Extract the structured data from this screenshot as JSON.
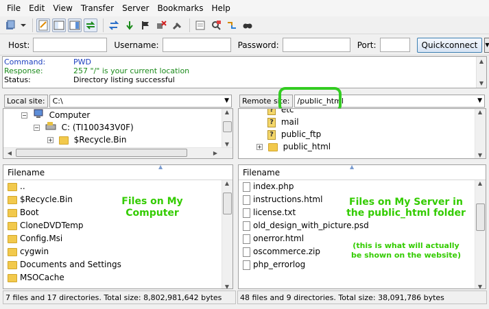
{
  "menu": [
    "File",
    "Edit",
    "View",
    "Transfer",
    "Server",
    "Bookmarks",
    "Help"
  ],
  "quickconnect": {
    "host_label": "Host:",
    "host_value": "",
    "username_label": "Username:",
    "username_value": "",
    "password_label": "Password:",
    "password_value": "",
    "port_label": "Port:",
    "port_value": "",
    "button_label": "Quickconnect"
  },
  "log": [
    {
      "type": "Command:",
      "text": "PWD"
    },
    {
      "type": "Response:",
      "text": "257 \"/\" is your current location"
    },
    {
      "type": "Status:",
      "text": "Directory listing successful"
    }
  ],
  "local": {
    "site_label": "Local site:",
    "path": "C:\\",
    "tree": [
      {
        "label": "Computer",
        "icon": "computer-icon"
      },
      {
        "label": "C: (TI100343V0F)",
        "icon": "drive-icon"
      },
      {
        "label": "$Recycle.Bin",
        "icon": "folder-icon"
      }
    ],
    "column": "Filename",
    "files": [
      "..",
      "$Recycle.Bin",
      "Boot",
      "CloneDVDTemp",
      "Config.Msi",
      "cygwin",
      "Documents and Settings",
      "MSOCache"
    ],
    "status": "7 files and 17 directories. Total size: 8,802,981,642 bytes",
    "annotation": "Files on My Computer"
  },
  "remote": {
    "site_label": "Remote site:",
    "path": "/public_html",
    "tree": [
      {
        "label": "etc",
        "icon": "unknown-folder-icon"
      },
      {
        "label": "mail",
        "icon": "unknown-folder-icon"
      },
      {
        "label": "public_ftp",
        "icon": "unknown-folder-icon"
      },
      {
        "label": "public_html",
        "icon": "folder-icon"
      }
    ],
    "column": "Filename",
    "files": [
      "index.php",
      "instructions.html",
      "license.txt",
      "old_design_with_picture.psd",
      "onerror.html",
      "oscommerce.zip",
      "php_errorlog"
    ],
    "status": "48 files and 9 directories. Total size: 38,091,786 bytes",
    "annotation_title": "Files on My Server in the public_html folder",
    "annotation_note": "(this is what will actually be shown on the website)"
  },
  "colors": {
    "annotation": "#33cc00",
    "highlight": "#33cc22",
    "log_blue": "#1c3fbf",
    "log_green": "#1a8a1a"
  }
}
